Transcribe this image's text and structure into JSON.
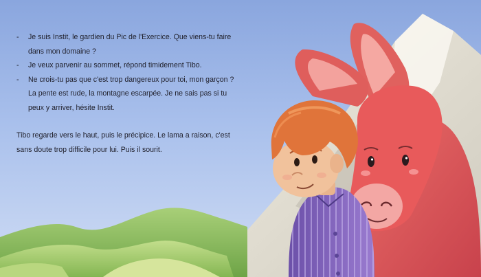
{
  "story": {
    "dialogue": [
      "Je suis Instit, le gardien du Pic de l'Exercice.  Que viens-tu faire dans mon domaine ?",
      "Je veux parvenir au sommet, répond timidement Tibo.",
      "Ne crois-tu pas que c'est trop dangereux pour toi, mon garçon ? La pente est rude, la montagne escarpée. Je ne sais pas si tu peux y arriver, hésite Instit."
    ],
    "dash": "-",
    "narration": "Tibo regarde vers le haut, puis le précipice. Le lama a raison, c'est sans doute trop difficile pour lui. Puis il sourit."
  },
  "colors": {
    "sky": "#8aa6de",
    "hills": "#8fbf5c",
    "boy_hair": "#e0743a",
    "boy_shirt": "#7f5fb8",
    "llama": "#e2585a"
  }
}
